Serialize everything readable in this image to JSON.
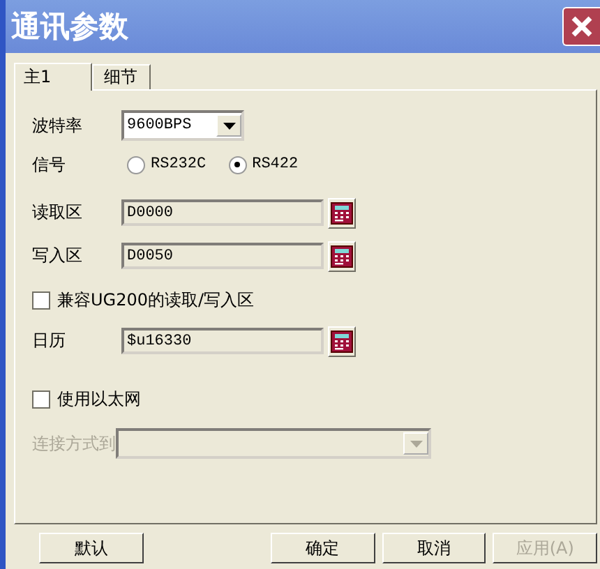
{
  "window": {
    "title": "通讯参数"
  },
  "tabs": [
    {
      "label": "主1",
      "selected": true
    },
    {
      "label": "细节",
      "selected": false
    }
  ],
  "baud_rate": {
    "label": "波特率",
    "value": "9600BPS"
  },
  "signal": {
    "label": "信号",
    "options": [
      {
        "label": "RS232C",
        "selected": false
      },
      {
        "label": "RS422",
        "selected": true
      }
    ]
  },
  "fields": [
    {
      "label": "读取区",
      "value": "D0000"
    },
    {
      "label": "写入区",
      "value": "D0050"
    }
  ],
  "compat": {
    "label": "兼容UG200的读取/写入区",
    "checked": false
  },
  "calendar": {
    "label": "日历",
    "value": "$u16330"
  },
  "ethernet": {
    "label": "使用以太网",
    "checked": false
  },
  "connect": {
    "label": "连接方式到",
    "disabled": true
  },
  "buttons": [
    {
      "label": "默认",
      "disabled": false
    },
    {
      "label": "确定",
      "disabled": false
    },
    {
      "label": "取消",
      "disabled": false
    },
    {
      "label": "应用(A)",
      "disabled": true
    }
  ]
}
